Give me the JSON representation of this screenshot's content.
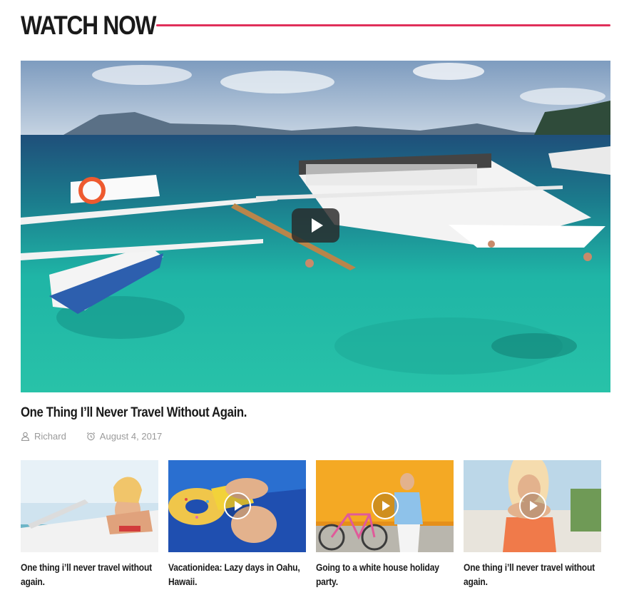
{
  "section": {
    "title": "WATCH NOW",
    "accent_color": "#e0305a"
  },
  "featured": {
    "title": "One Thing I’ll Never Travel Without Again.",
    "author": "Richard",
    "date": "August 4, 2017",
    "author_icon": "user-icon",
    "date_icon": "alarm-clock-icon",
    "play_icon": "play-icon"
  },
  "cards": [
    {
      "title": "One thing i’ll never travel without again.",
      "has_video": false
    },
    {
      "title": "Vacationidea: Lazy days in Oahu, Hawaii.",
      "has_video": true
    },
    {
      "title": "Going to a white house holiday party.",
      "has_video": true
    },
    {
      "title": "One thing i’ll never travel without again.",
      "has_video": true
    }
  ]
}
